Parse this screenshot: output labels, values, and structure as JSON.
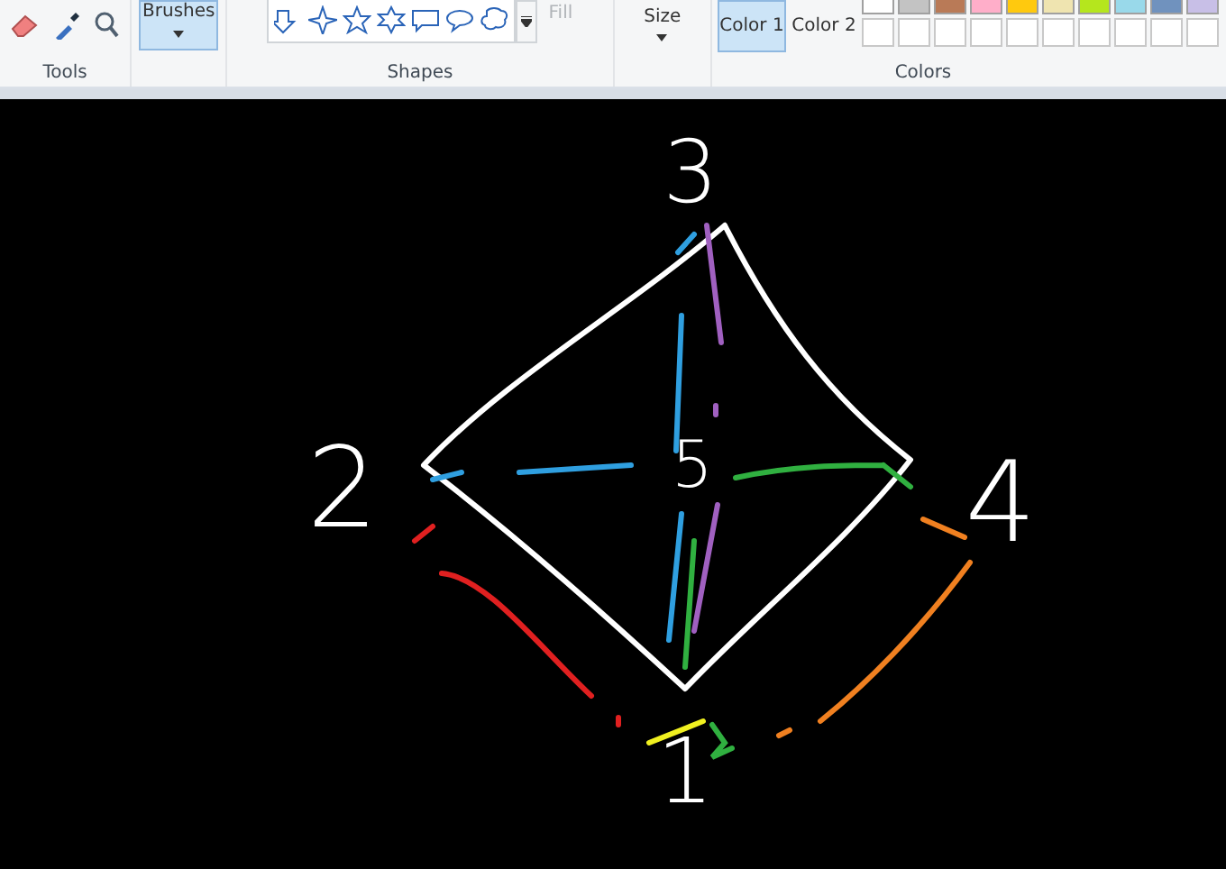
{
  "ribbon": {
    "tools": {
      "label": "Tools"
    },
    "brushes": {
      "label": "Brushes",
      "selected": true
    },
    "shapes": {
      "label": "Shapes",
      "fill": {
        "label": "Fill",
        "disabled": true
      }
    },
    "size": {
      "label": "Size"
    },
    "color_slots": [
      {
        "label": "Color 1",
        "selected": true
      },
      {
        "label": "Color 2",
        "selected": false
      }
    ],
    "colors": {
      "label": "Colors",
      "palette": [
        {
          "color": "#ffffff"
        },
        {
          "color": "#c3c3c3"
        },
        {
          "color": "#b97a57"
        },
        {
          "color": "#ffaec9"
        },
        {
          "color": "#ffc90e"
        },
        {
          "color": "#efe4b0"
        },
        {
          "color": "#b5e61d"
        },
        {
          "color": "#99d9ea"
        },
        {
          "color": "#7092be"
        },
        {
          "color": "#c8bfe7"
        }
      ]
    }
  },
  "canvas": {
    "nodes": [
      {
        "label": "3"
      },
      {
        "label": "2"
      },
      {
        "label": "5"
      },
      {
        "label": "4"
      },
      {
        "label": "1"
      }
    ]
  }
}
